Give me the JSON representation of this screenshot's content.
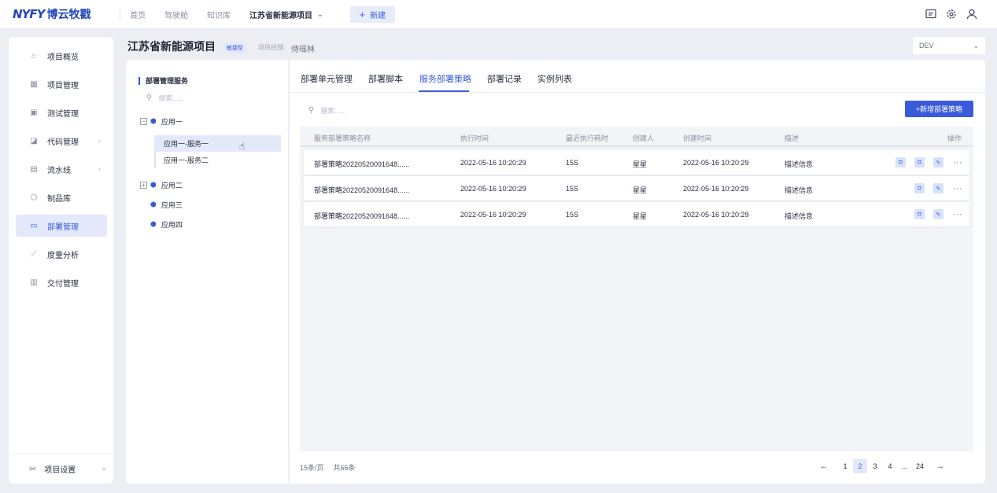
{
  "brand": {
    "mark": "NYFY",
    "name": "博云牧戳"
  },
  "topnav": {
    "items": [
      "首页",
      "驾驶舱",
      "知识库"
    ],
    "project": "江苏省新能源项目",
    "new_label": "新建"
  },
  "top_icons": [
    "message-icon",
    "settings-icon",
    "user-icon"
  ],
  "sidebar": {
    "items": [
      {
        "label": "项目概览",
        "icon": "house-icon",
        "arrow": false
      },
      {
        "label": "项目管理",
        "icon": "grid-icon",
        "arrow": false
      },
      {
        "label": "测试管理",
        "icon": "test-icon",
        "arrow": false
      },
      {
        "label": "代码管理",
        "icon": "code-icon",
        "arrow": true
      },
      {
        "label": "流水线",
        "icon": "pipeline-icon",
        "arrow": true
      },
      {
        "label": "制品库",
        "icon": "package-icon",
        "arrow": false
      },
      {
        "label": "部署管理",
        "icon": "deploy-icon",
        "arrow": false,
        "active": true
      },
      {
        "label": "度量分析",
        "icon": "chart-icon",
        "arrow": false
      },
      {
        "label": "交付管理",
        "icon": "delivery-icon",
        "arrow": false
      }
    ],
    "footer_label": "项目设置"
  },
  "header": {
    "title": "江苏省新能源项目",
    "badge": "敏捷型",
    "pm_label": "项目经理:",
    "pm_value": "侍瑶林",
    "env": "DEV"
  },
  "tree": {
    "title": "部署管理服务",
    "search_placeholder": "搜索......",
    "apps": [
      {
        "label": "应用一",
        "toggle": "−",
        "children": [
          "应用一-服务一",
          "应用一-服务二"
        ]
      },
      {
        "label": "应用二",
        "toggle": "+"
      },
      {
        "label": "应用三"
      },
      {
        "label": "应用四"
      }
    ]
  },
  "tabs": [
    "部署单元管理",
    "部署脚本",
    "服务部署策略",
    "部署记录",
    "实例列表"
  ],
  "active_tab": 2,
  "main": {
    "search_placeholder": "搜索......",
    "add_button": "+新增部署策略"
  },
  "table": {
    "columns": [
      "服务部署策略名称",
      "执行时间",
      "最近执行耗时",
      "创建人",
      "创建时间",
      "描述",
      "操作"
    ],
    "rows": [
      [
        "部署策略20220520091648......",
        "2022-05-16 10:20:29",
        "15S",
        "星星",
        "2022-05-16 10:20:29",
        "描述信息"
      ],
      [
        "部署策略20220520091648......",
        "2022-05-16 10:20:29",
        "15S",
        "星星",
        "2022-05-16 10:20:29",
        "描述信息"
      ],
      [
        "部署策略20220520091648......",
        "2022-05-16 10:20:29",
        "15S",
        "星星",
        "2022-05-16 10:20:29",
        "描述信息"
      ]
    ]
  },
  "footer": {
    "per_page": "15条/页",
    "total": "共66条",
    "pages": [
      "1",
      "2",
      "3",
      "4",
      "...",
      "24"
    ],
    "current_page": "2"
  },
  "colors": {
    "accent": "#3a5bd9",
    "brand": "#2146b8",
    "active_bg": "#e3e9fb"
  }
}
